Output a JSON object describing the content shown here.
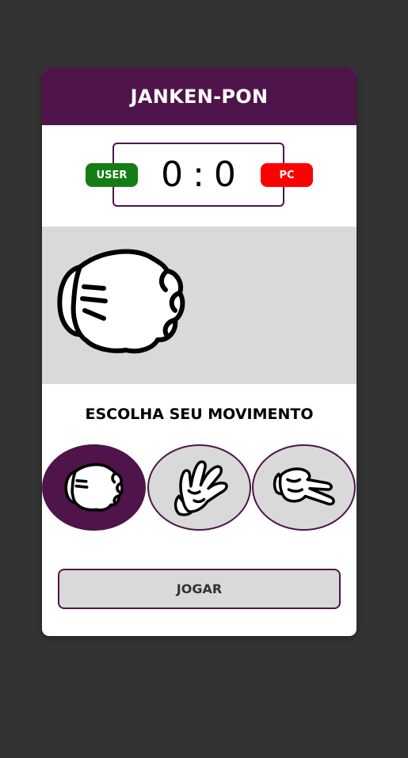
{
  "header": {
    "title": "JANKEN-PON"
  },
  "score": {
    "user_label": "USER",
    "pc_label": "PC",
    "user_score": "0",
    "separator": ":",
    "pc_score": "0"
  },
  "arena": {
    "user_hand_icon": "rock-hand-icon"
  },
  "moves": {
    "title": "ESCOLHA SEU MOVIMENTO",
    "options": [
      {
        "icon": "rock-hand-icon",
        "selected": true
      },
      {
        "icon": "paper-hand-icon",
        "selected": false
      },
      {
        "icon": "scissors-hand-icon",
        "selected": false
      }
    ]
  },
  "play_button": {
    "label": "JOGAR"
  },
  "colors": {
    "primary": "#4f1449",
    "user_badge": "#157d15",
    "pc_badge": "#ff0000",
    "arena_bg": "#d9d9d9",
    "page_bg": "#333333"
  }
}
